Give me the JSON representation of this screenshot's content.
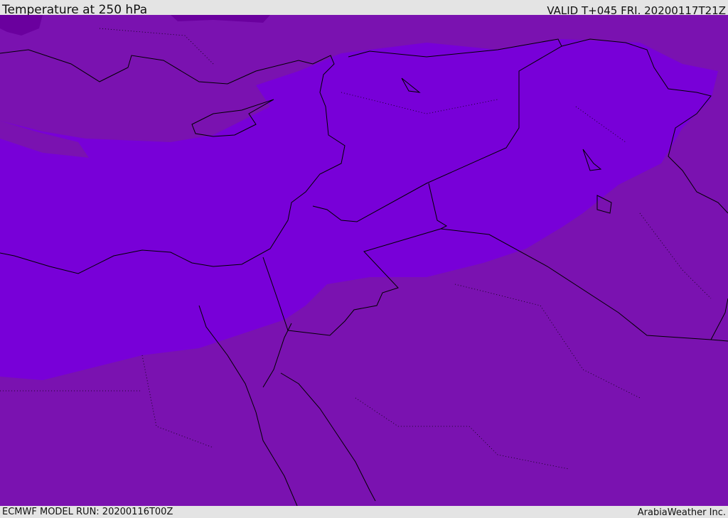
{
  "header": {
    "title": "Temperature at 250 hPa",
    "valid": "VALID T+045 FRI. 20200117T21Z"
  },
  "footer": {
    "model_run": "ECMWF MODEL RUN: 20200116T00Z",
    "credit": "ArabiaWeather Inc."
  },
  "colors": {
    "base": "#7a12b0",
    "cold": "#7800d8",
    "colder": "#6a009e",
    "border": "#000000"
  }
}
